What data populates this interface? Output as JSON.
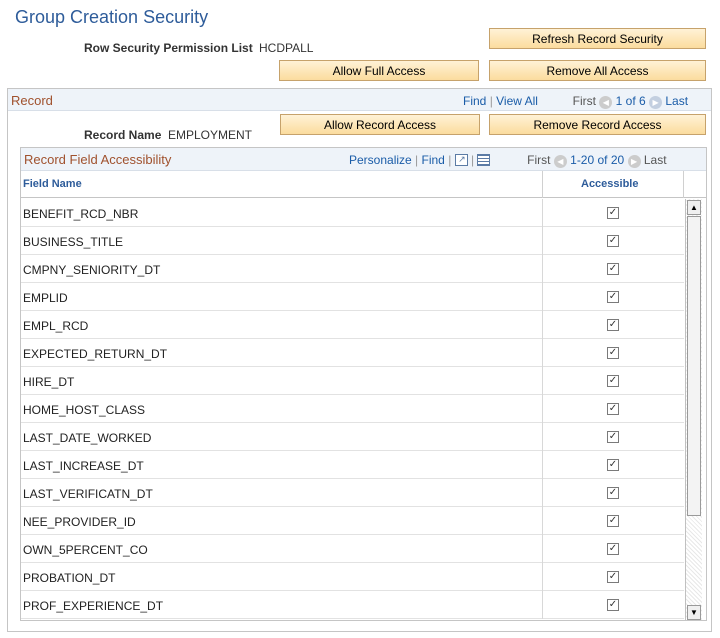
{
  "page": {
    "title": "Group Creation Security"
  },
  "permission": {
    "label": "Row Security Permission List",
    "value": "HCDPALL"
  },
  "buttons": {
    "refresh": "Refresh Record Security",
    "allow_full": "Allow Full Access",
    "remove_all": "Remove All Access",
    "allow_record": "Allow Record Access",
    "remove_record": "Remove Record Access"
  },
  "record": {
    "label": "Record",
    "find": "Find",
    "view_all": "View All",
    "first": "First",
    "position": "1 of 6",
    "last": "Last",
    "name_label": "Record Name",
    "name_value": "EMPLOYMENT"
  },
  "grid": {
    "title": "Record Field Accessibility",
    "personalize": "Personalize",
    "find": "Find",
    "first": "First",
    "range": "1-20 of 20",
    "last": "Last",
    "col_field": "Field Name",
    "col_accessible": "Accessible",
    "rows": [
      {
        "field": "BENEFIT_RCD_NBR",
        "accessible": true
      },
      {
        "field": "BUSINESS_TITLE",
        "accessible": true
      },
      {
        "field": "CMPNY_SENIORITY_DT",
        "accessible": true
      },
      {
        "field": "EMPLID",
        "accessible": true
      },
      {
        "field": "EMPL_RCD",
        "accessible": true
      },
      {
        "field": "EXPECTED_RETURN_DT",
        "accessible": true
      },
      {
        "field": "HIRE_DT",
        "accessible": true
      },
      {
        "field": "HOME_HOST_CLASS",
        "accessible": true
      },
      {
        "field": "LAST_DATE_WORKED",
        "accessible": true
      },
      {
        "field": "LAST_INCREASE_DT",
        "accessible": true
      },
      {
        "field": "LAST_VERIFICATN_DT",
        "accessible": true
      },
      {
        "field": "NEE_PROVIDER_ID",
        "accessible": true
      },
      {
        "field": "OWN_5PERCENT_CO",
        "accessible": true
      },
      {
        "field": "PROBATION_DT",
        "accessible": true
      },
      {
        "field": "PROF_EXPERIENCE_DT",
        "accessible": true
      }
    ]
  }
}
